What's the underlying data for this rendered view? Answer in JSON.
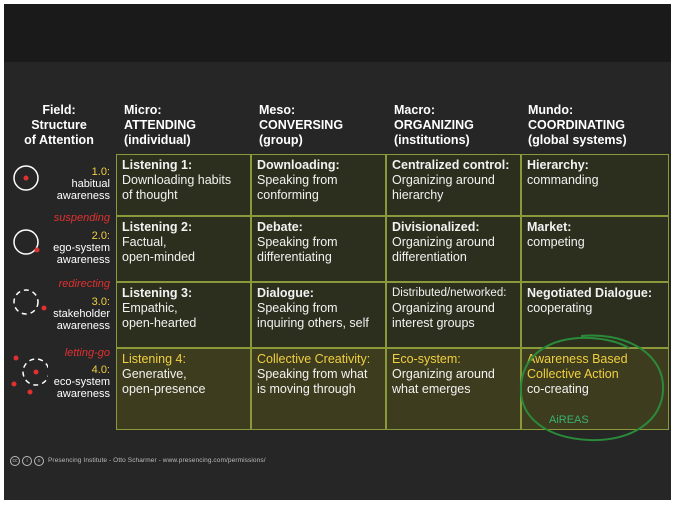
{
  "field_header": [
    "Field:",
    "Structure",
    "of Attention"
  ],
  "columns": [
    {
      "line1": "Micro:",
      "line2": "ATTENDING",
      "line3": "(individual)"
    },
    {
      "line1": "Meso:",
      "line2": "CONVERSING",
      "line3": "(group)"
    },
    {
      "line1": "Macro:",
      "line2": "ORGANIZING",
      "line3": "(institutions)"
    },
    {
      "line1": "Mundo:",
      "line2": "COORDINATING",
      "line3": "(global systems)"
    }
  ],
  "levels": [
    {
      "num": "1.0:",
      "a": "habitual",
      "b": "awareness"
    },
    {
      "num": "2.0:",
      "a": "ego-system",
      "b": "awareness"
    },
    {
      "num": "3.0:",
      "a": "stakeholder",
      "b": "awareness"
    },
    {
      "num": "4.0:",
      "a": "eco-system",
      "b": "awareness"
    }
  ],
  "transitions": [
    "suspending",
    "redirecting",
    "letting-go"
  ],
  "rows": [
    [
      {
        "title": "Listening 1:",
        "l1": "Downloading habits",
        "l2": "of thought"
      },
      {
        "title": "Downloading:",
        "l1": "Speaking from",
        "l2": "conforming"
      },
      {
        "title": "Centralized control:",
        "l1": "Organizing around",
        "l2": "hierarchy"
      },
      {
        "title": "Hierarchy:",
        "l1": "commanding",
        "l2": ""
      }
    ],
    [
      {
        "title": "Listening 2:",
        "l1": "Factual,",
        "l2": "open-minded"
      },
      {
        "title": "Debate:",
        "l1": "Speaking from",
        "l2": "differentiating"
      },
      {
        "title": "Divisionalized:",
        "l1": "Organizing around",
        "l2": "differentiation"
      },
      {
        "title": "Market:",
        "l1": "competing",
        "l2": ""
      }
    ],
    [
      {
        "title": "Listening 3:",
        "l1": "Empathic,",
        "l2": "open-hearted"
      },
      {
        "title": "Dialogue:",
        "l1": "Speaking from",
        "l2": "inquiring others, self"
      },
      {
        "title": "Distributed/networked:",
        "l1": "Organizing around",
        "l2": "interest groups"
      },
      {
        "title": "Negotiated Dialogue:",
        "l1": "cooperating",
        "l2": ""
      }
    ],
    [
      {
        "title": "Listening 4:",
        "l1": "Generative,",
        "l2": "open-presence"
      },
      {
        "title": "Collective Creativity:",
        "l1": "Speaking from what",
        "l2": "is moving through"
      },
      {
        "title": "Eco-system:",
        "l1": "Organizing around",
        "l2": "what emerges"
      },
      {
        "title": "Awareness Based",
        "l1": "Collective Action",
        "l2": "co-creating"
      }
    ]
  ],
  "annotation": "AiREAS",
  "footer": "Presencing Institute - Otto Scharmer - www.presencing.com/permissions/",
  "colors": {
    "slide_bg": "#262626",
    "cell_border": "#8a9a3a",
    "highlight_text": "#f0d040",
    "red_accent": "#e03030",
    "circle_annotation": "#2a8a3a"
  }
}
